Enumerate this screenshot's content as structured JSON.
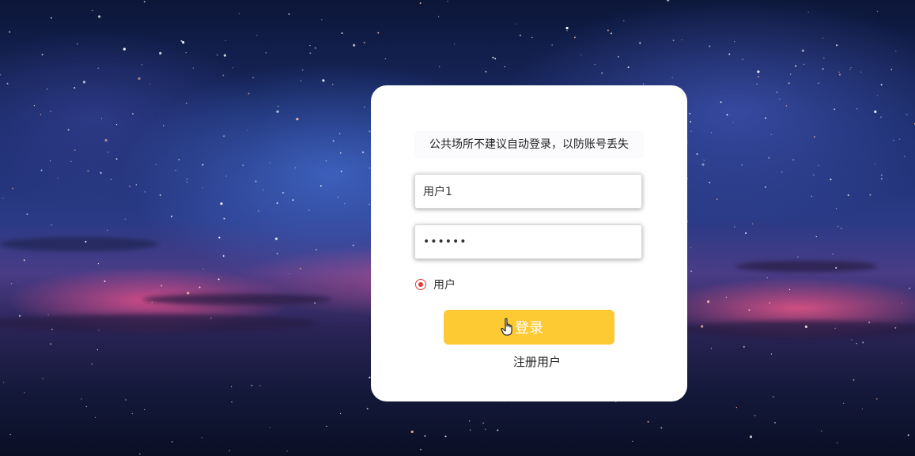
{
  "login_card": {
    "notice": "公共场所不建议自动登录，以防账号丢失",
    "username": {
      "value": "用户1"
    },
    "password": {
      "value": "••••••"
    },
    "role": {
      "label": "用户",
      "selected": true
    },
    "login_button": "登录",
    "register_link": "注册用户"
  },
  "colors": {
    "accent": "#fdca34",
    "radio": "#e23a3a",
    "card": "#ffffff"
  },
  "icons": {
    "cursor": "hand-pointer-icon"
  }
}
